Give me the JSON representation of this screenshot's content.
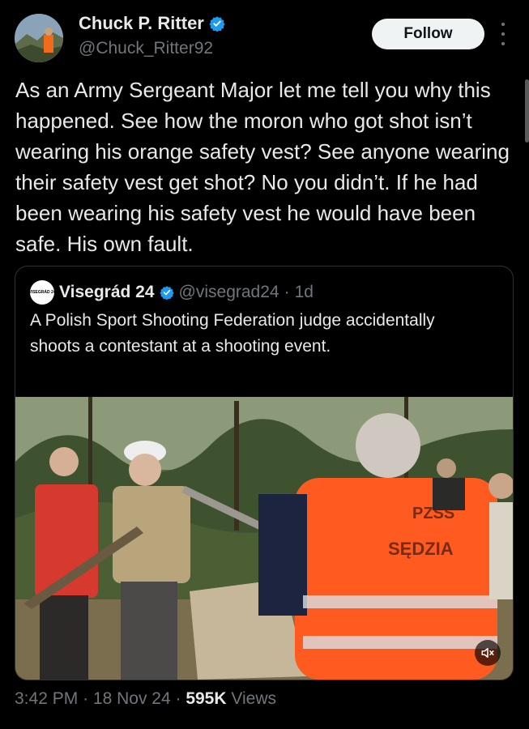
{
  "author": {
    "name": "Chuck P. Ritter",
    "handle": "@Chuck_Ritter92",
    "verified": true
  },
  "follow_label": "Follow",
  "tweet_text": "As an Army Sergeant Major let me tell you why this happened. See how the moron who got shot isn’t wearing his orange safety vest? See anyone wearing their safety vest get shot? No you didn’t. If he had been wearing his safety vest he would have been safe. His own fault.",
  "quote": {
    "name": "Visegrád 24",
    "handle": "@visegrad24",
    "separator": "·",
    "time": "1d",
    "avatar_text": "VISEGRÁD 24",
    "text": "A Polish Sport Shooting Federation judge accidentally shoots a contestant at a shooting event.",
    "media": {
      "vest_text_line1": "PZSS",
      "vest_text_line2": "SĘDZIA",
      "mute_icon": "speaker-muted-icon"
    }
  },
  "meta": {
    "time": "3:42 PM",
    "sep1": "·",
    "date": "18 Nov 24",
    "sep2": "·",
    "views_count": "595K",
    "views_label": "Views"
  },
  "colors": {
    "background": "#000000",
    "text": "#e7e9ea",
    "muted": "#71767b",
    "verified": "#1d9bf0",
    "follow_bg": "#eff3f4",
    "vest_orange": "#ff5a1f"
  }
}
